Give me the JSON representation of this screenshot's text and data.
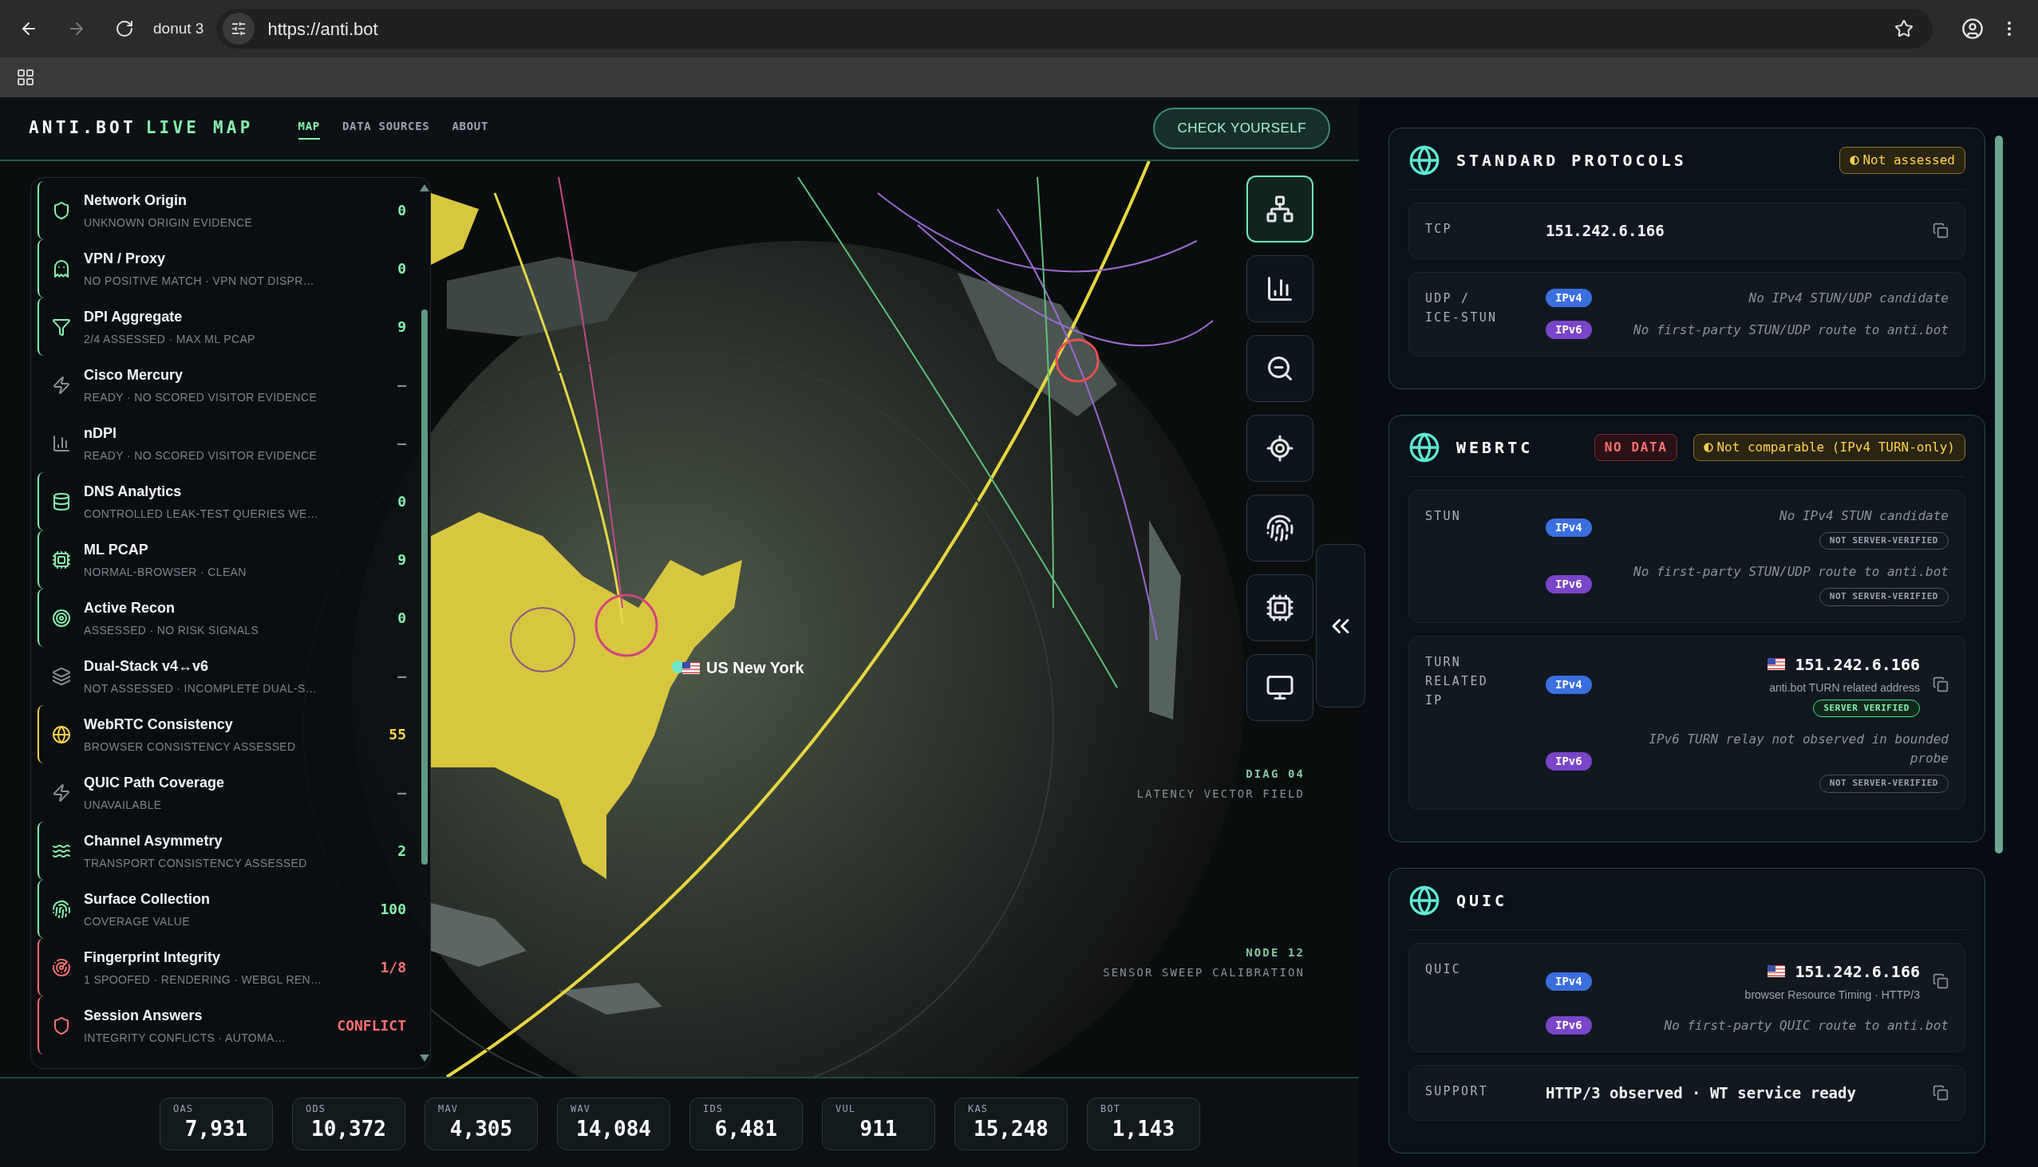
{
  "browser": {
    "tab_title": "donut 3",
    "url": "https://anti.bot"
  },
  "header": {
    "logo": "ANTI.BOT",
    "logo_accent": "LIVE MAP",
    "nav": [
      {
        "label": "MAP",
        "selected": true
      },
      {
        "label": "DATA SOURCES",
        "selected": false
      },
      {
        "label": "ABOUT",
        "selected": false
      }
    ],
    "cta": "CHECK YOURSELF"
  },
  "sidebar": {
    "items": [
      {
        "name": "Network Origin",
        "detail": "UNKNOWN ORIGIN EVIDENCE",
        "value": "0",
        "color": "#86efac",
        "highlighted": true
      },
      {
        "name": "VPN / Proxy",
        "detail": "NO POSITIVE MATCH · VPN NOT DISPR…",
        "value": "0",
        "color": "#86efac",
        "highlighted": true
      },
      {
        "name": "DPI Aggregate",
        "detail": "2/4 ASSESSED · MAX ML PCAP",
        "value": "9",
        "color": "#86efac",
        "highlighted": true
      },
      {
        "name": "Cisco Mercury",
        "detail": "READY · NO SCORED VISITOR EVIDENCE",
        "value": "—",
        "color": "#8a8f98",
        "highlighted": false
      },
      {
        "name": "nDPI",
        "detail": "READY · NO SCORED VISITOR EVIDENCE",
        "value": "—",
        "color": "#8a8f98",
        "highlighted": false
      },
      {
        "name": "DNS Analytics",
        "detail": "CONTROLLED LEAK-TEST QUERIES WE…",
        "value": "0",
        "color": "#86efac",
        "highlighted": true
      },
      {
        "name": "ML PCAP",
        "detail": "NORMAL-BROWSER · CLEAN",
        "value": "9",
        "color": "#86efac",
        "highlighted": true
      },
      {
        "name": "Active Recon",
        "detail": "ASSESSED · NO RISK SIGNALS",
        "value": "0",
        "color": "#86efac",
        "highlighted": true
      },
      {
        "name": "Dual-Stack v4↔v6",
        "detail": "NOT ASSESSED · INCOMPLETE DUAL-S…",
        "value": "—",
        "color": "#8a8f98",
        "highlighted": false
      },
      {
        "name": "WebRTC Consistency",
        "detail": "BROWSER CONSISTENCY ASSESSED",
        "value": "55",
        "color": "#fcd34d",
        "highlighted": true
      },
      {
        "name": "QUIC Path Coverage",
        "detail": "UNAVAILABLE",
        "value": "—",
        "color": "#8a8f98",
        "highlighted": false
      },
      {
        "name": "Channel Asymmetry",
        "detail": "TRANSPORT CONSISTENCY ASSESSED",
        "value": "2",
        "color": "#86efac",
        "highlighted": true
      },
      {
        "name": "Surface Collection",
        "detail": "COVERAGE VALUE",
        "value": "100",
        "color": "#86efac",
        "highlighted": true
      },
      {
        "name": "Fingerprint Integrity",
        "detail": "1 SPOOFED · RENDERING · WEBGL REN…",
        "value": "1/8",
        "color": "#f87171",
        "highlighted": true
      },
      {
        "name": "Session Answers",
        "detail": "INTEGRITY CONFLICTS · AUTOMA…",
        "value": "CONFLICT",
        "color": "#f87171",
        "highlighted": true
      }
    ]
  },
  "map": {
    "location": {
      "country": "US",
      "city": "New York"
    },
    "labels": [
      {
        "code": "DIAG 04",
        "caption": "LATENCY VECTOR FIELD"
      },
      {
        "code": "NODE 12",
        "caption": "SENSOR SWEEP CALIBRATION"
      }
    ],
    "toolbar": [
      {
        "selected": true
      },
      {
        "selected": false
      },
      {
        "selected": false
      },
      {
        "selected": false
      },
      {
        "selected": false
      },
      {
        "selected": false
      },
      {
        "selected": false
      }
    ]
  },
  "stats": [
    {
      "label": "OAS",
      "value": "7,931"
    },
    {
      "label": "ODS",
      "value": "10,372"
    },
    {
      "label": "MAV",
      "value": "4,305"
    },
    {
      "label": "WAV",
      "value": "14,084"
    },
    {
      "label": "IDS",
      "value": "6,481"
    },
    {
      "label": "VUL",
      "value": "911"
    },
    {
      "label": "KAS",
      "value": "15,248"
    },
    {
      "label": "BOT",
      "value": "1,143"
    }
  ],
  "cards": [
    {
      "title": "STANDARD PROTOCOLS",
      "badges": [
        {
          "kind": "warn",
          "text": "Not assessed"
        }
      ],
      "rows": [
        {
          "label": "TCP",
          "entries": [
            {
              "kind": "value",
              "text": "151.242.6.166",
              "copy": true
            }
          ]
        },
        {
          "label": "UDP / ICE-STUN",
          "entries": [
            {
              "kind": "note",
              "ip": "IPv4",
              "color": "#3b6fe0",
              "text": "No IPv4 STUN/UDP candidate"
            },
            {
              "kind": "note",
              "ip": "IPv6",
              "color": "#7a45c8",
              "text": "No first-party STUN/UDP route to anti.bot"
            }
          ]
        }
      ]
    },
    {
      "title": "WEBRTC",
      "badges": [
        {
          "kind": "error",
          "text": "NO DATA"
        },
        {
          "kind": "warn",
          "text": "Not comparable (IPv4 TURN-only)"
        }
      ],
      "rows": [
        {
          "label": "STUN",
          "entries": [
            {
              "kind": "note",
              "ip": "IPv4",
              "color": "#3b6fe0",
              "text": "No IPv4 STUN candidate",
              "check": {
                "text": "NOT SERVER-VERIFIED",
                "verified": false
              }
            },
            {
              "kind": "note",
              "ip": "IPv6",
              "color": "#7a45c8",
              "text": "No first-party STUN/UDP route to anti.bot",
              "check": {
                "text": "NOT SERVER-VERIFIED",
                "verified": false
              }
            }
          ]
        },
        {
          "label": "TURN RELATED IP",
          "entries": [
            {
              "kind": "address",
              "ip": "IPv4",
              "color": "#3b6fe0",
              "text": "151.242.6.166",
              "sub": "anti.bot TURN related address",
              "copy": true,
              "check": {
                "text": "SERVER VERIFIED",
                "verified": true
              }
            },
            {
              "kind": "note",
              "ip": "IPv6",
              "color": "#7a45c8",
              "text": "IPv6 TURN relay not observed in bounded probe",
              "check": {
                "text": "NOT SERVER-VERIFIED",
                "verified": false
              }
            }
          ]
        }
      ]
    },
    {
      "title": "QUIC",
      "rows": [
        {
          "label": "QUIC",
          "entries": [
            {
              "kind": "address",
              "ip": "IPv4",
              "color": "#3b6fe0",
              "text": "151.242.6.166",
              "sub": "browser Resource Timing · HTTP/3",
              "copy": true
            },
            {
              "kind": "note",
              "ip": "IPv6",
              "color": "#7a45c8",
              "text": "No first-party QUIC route to anti.bot"
            }
          ]
        },
        {
          "label": "SUPPORT",
          "entries": [
            {
              "kind": "value",
              "text": "HTTP/3 observed · WT service ready",
              "copy": true
            }
          ]
        }
      ]
    }
  ]
}
